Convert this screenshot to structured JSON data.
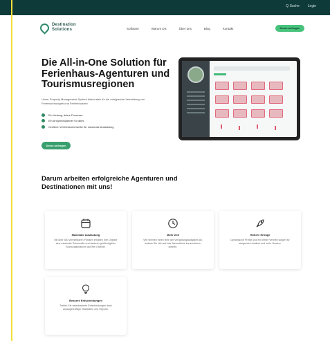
{
  "topbar": {
    "links": [
      "Q Suche",
      "Login"
    ]
  },
  "navbar": {
    "logo_line1": "Destination",
    "logo_line2": "Solutions",
    "links": [
      "Software",
      "Warum DS",
      "Über uns",
      "Blog",
      "Kontakt"
    ],
    "cta": "Demo anfragen"
  },
  "hero": {
    "title": "Die All-in-One Solution für Ferienhaus-Agenturen und Tourismusregionen",
    "subtitle": "Unser Property Management System bietet alles für die erfolgreiche Vermietung von Ferienwohnungen und Ferienhäusern.",
    "bullets": [
      "Ein Vertrag, deine Prozesse",
      "Ein Ansprechpartner für alles",
      "Größere Vertriebsreichweite für maximale Auslastung"
    ],
    "cta": "Demo anfragen"
  },
  "section": {
    "title": "Darum arbeiten erfolgreiche Agenturen und Destinationen mit uns!"
  },
  "features": [
    {
      "icon": "calendar-icon",
      "title": "Maximale Auslastung",
      "text": "Mit über 300 vermietbaren Portalen erhalten Ihre Objekte eine maximale Reichweite und dadurch größtmögliche Buchungschancen auf Ihre Objekte."
    },
    {
      "icon": "clock-icon",
      "title": "Mehr Zeit",
      "text": "Wir nehmen Ihnen viele der Verwaltungsaufgaben ab, sodass Sie sich auf das Wesentliche konzentrieren können."
    },
    {
      "icon": "rocket-icon",
      "title": "Höhere Erträge",
      "text": "Dynamische Preise und ein breiter Vertrieb sorgen für steigende Umsätze und mehr Gewinn."
    },
    {
      "icon": "lightbulb-icon",
      "title": "Bessere Entscheidungen",
      "text": "Treffen Sie datenbasierte Entscheidungen dank aussagekräftiger Statistiken und Reports."
    }
  ],
  "colors": {
    "topbar": "#0e3b3a",
    "accent": "#48c37c",
    "booking_mark": "#e06b7d"
  }
}
